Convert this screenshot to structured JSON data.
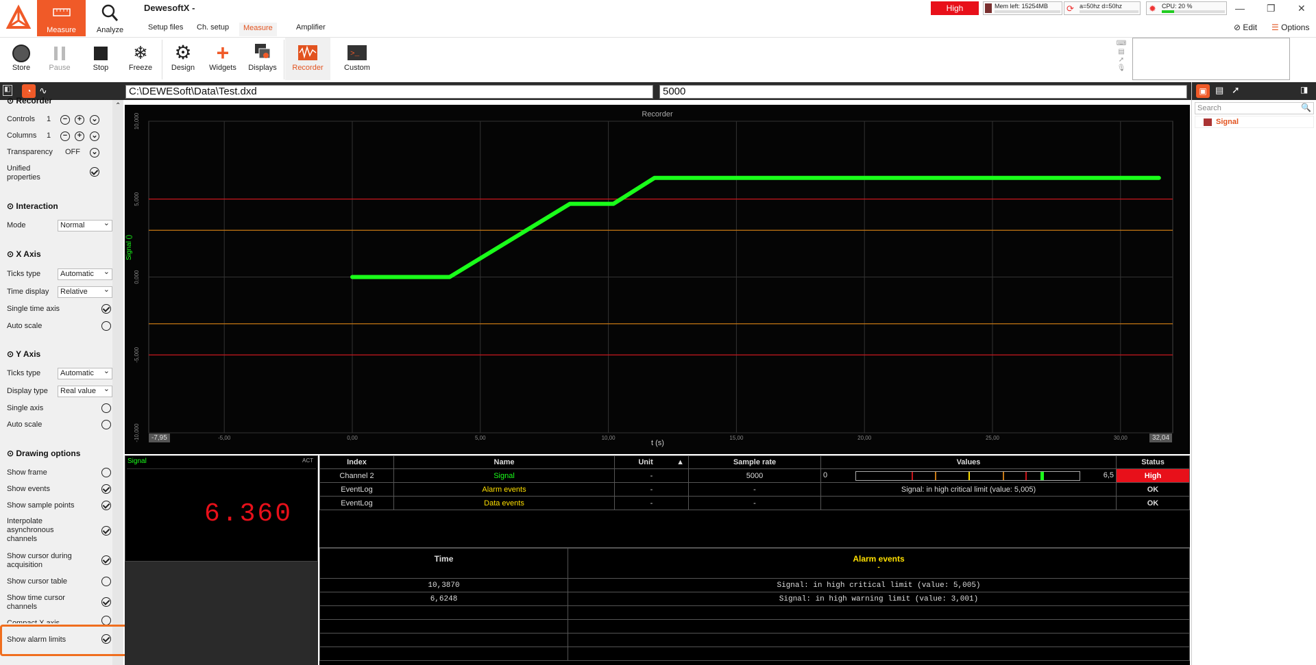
{
  "title_bar": {
    "app_title": "DewesoftX -",
    "tabs": [
      {
        "label": "Measure"
      },
      {
        "label": "Analyze"
      }
    ],
    "menu": [
      "Setup files",
      "Ch. setup",
      "Measure",
      "Amplifier"
    ],
    "status_label": "High",
    "mem_text": "Mem left: 15254MB",
    "sync_text": "a=50hz d=50hz",
    "cpu_text": "CPU: 20 %",
    "edit_label": "Edit",
    "options_label": "Options"
  },
  "toolbar": {
    "buttons": [
      {
        "label": "Store",
        "icon": "record-icon"
      },
      {
        "label": "Pause",
        "icon": "pause-icon"
      },
      {
        "label": "Stop",
        "icon": "stop-icon"
      },
      {
        "label": "Freeze",
        "icon": "snowflake-icon"
      },
      {
        "label": "Design",
        "icon": "gear-icon"
      },
      {
        "label": "Widgets",
        "icon": "plus-icon"
      },
      {
        "label": "Displays",
        "icon": "displays-icon"
      },
      {
        "label": "Recorder",
        "icon": "recorder-icon"
      },
      {
        "label": "Custom",
        "icon": "terminal-icon"
      }
    ]
  },
  "path_bar": {
    "file_path": "C:\\DEWESoft\\Data\\Test.dxd",
    "sample_value": "5000"
  },
  "left_panel": {
    "recorder_header": "Recorder",
    "controls_label": "Controls",
    "controls_value": "1",
    "columns_label": "Columns",
    "columns_value": "1",
    "transparency_label": "Transparency",
    "transparency_value": "OFF",
    "unified_label": "Unified properties",
    "interaction_header": "Interaction",
    "mode_label": "Mode",
    "mode_value": "Normal",
    "xaxis_header": "X Axis",
    "x_ticks_label": "Ticks type",
    "x_ticks_value": "Automatic",
    "time_display_label": "Time display",
    "time_display_value": "Relative",
    "single_time_label": "Single time axis",
    "x_auto_scale_label": "Auto scale",
    "yaxis_header": "Y Axis",
    "y_ticks_label": "Ticks type",
    "y_ticks_value": "Automatic",
    "display_type_label": "Display type",
    "display_type_value": "Real value",
    "single_axis_label": "Single axis",
    "y_auto_scale_label": "Auto scale",
    "drawing_header": "Drawing options",
    "options": [
      {
        "label": "Show frame",
        "checked": false
      },
      {
        "label": "Show events",
        "checked": true
      },
      {
        "label": "Show sample points",
        "checked": true
      },
      {
        "label": "Interpolate asynchronous channels",
        "checked": true
      },
      {
        "label": "Show cursor during acquisition",
        "checked": true
      },
      {
        "label": "Show cursor table",
        "checked": false
      },
      {
        "label": "Show time cursor channels",
        "checked": true
      },
      {
        "label": "Compact X axis",
        "checked": false
      },
      {
        "label": "Show alarm limits",
        "checked": true
      }
    ]
  },
  "recorder": {
    "title": "Recorder",
    "ylabel": "Signal ()",
    "xlabel": "t (s)",
    "xmin_label": "-7,95",
    "xmax_label": "32,04",
    "colors": {
      "signal": "#1aff1a",
      "critical": "#c8141a",
      "warning": "#c87814"
    }
  },
  "chart_data": {
    "type": "line",
    "title": "Recorder",
    "xlabel": "t (s)",
    "ylabel": "Signal ()",
    "xlim": [
      -7.95,
      32.04
    ],
    "ylim": [
      -10,
      10
    ],
    "x_ticks": [
      "-5,00",
      "0,00",
      "5,00",
      "10,00",
      "15,00",
      "20,00",
      "25,00",
      "30,00"
    ],
    "y_ticks": [
      "10,000",
      "5,000",
      "0,000",
      "-5,000",
      "-10,000"
    ],
    "series": [
      {
        "name": "Signal",
        "points": [
          [
            0,
            0
          ],
          [
            3.8,
            0
          ],
          [
            8.5,
            4.7
          ],
          [
            10.2,
            4.7
          ],
          [
            11.8,
            6.36
          ],
          [
            31.5,
            6.36
          ]
        ]
      }
    ],
    "limits": {
      "critical_high": 5.005,
      "warning_high": 3.001,
      "warning_low": -3.0,
      "critical_low": -5.0
    }
  },
  "digital_meter": {
    "channel": "Signal",
    "tag": "ACT",
    "value": "6.360"
  },
  "channel_table": {
    "headers": [
      "Index",
      "Name",
      "Unit",
      "Sample rate",
      "Values",
      "Status"
    ],
    "rows": [
      {
        "index": "Channel 2",
        "name": "Signal",
        "unit": "-",
        "rate": "5000",
        "values_min": "0",
        "values_max": "6,5",
        "status": "High"
      },
      {
        "index": "EventLog",
        "name": "Alarm events",
        "unit": "-",
        "rate": "-",
        "values_text": "Signal: in high critical limit (value: 5,005)",
        "status": "OK"
      },
      {
        "index": "EventLog",
        "name": "Data events",
        "unit": "-",
        "rate": "-",
        "values_text": "",
        "status": "OK"
      }
    ]
  },
  "event_table": {
    "time_header": "Time",
    "event_header": "Alarm events",
    "event_sub": "-",
    "rows": [
      {
        "time": "10,3870",
        "text": "Signal: in high critical limit (value: 5,005)"
      },
      {
        "time": "6,6248",
        "text": "Signal: in high warning limit (value: 3,001)"
      }
    ]
  },
  "right_panel": {
    "search_placeholder": "Search",
    "channel": "Signal"
  }
}
